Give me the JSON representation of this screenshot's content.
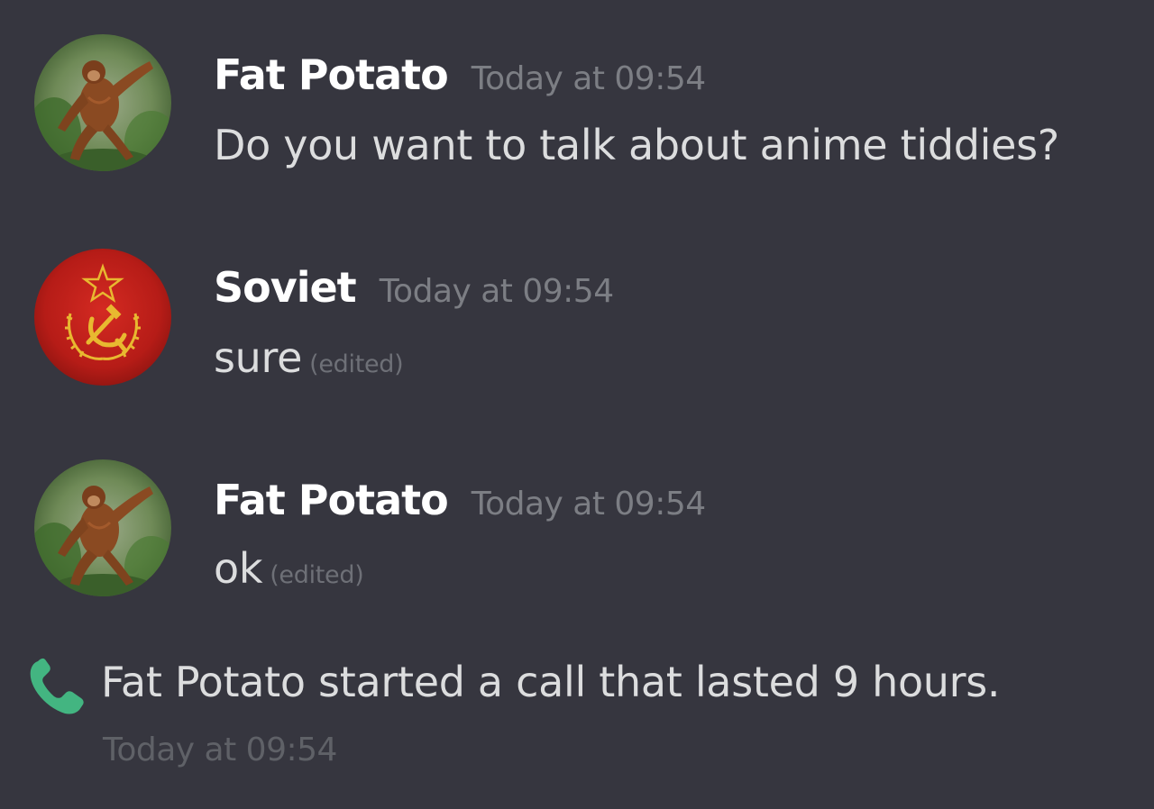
{
  "messages": [
    {
      "username": "Fat Potato",
      "timestamp": "Today at 09:54",
      "text": "Do you want to talk about anime tiddies?",
      "avatar_icon": "orangutan-avatar-icon"
    },
    {
      "username": "Soviet",
      "timestamp": "Today at 09:54",
      "text": "sure",
      "edited": "(edited)",
      "avatar_icon": "soviet-emblem-avatar-icon"
    },
    {
      "username": "Fat Potato",
      "timestamp": "Today at 09:54",
      "text": "ok",
      "edited": "(edited)",
      "avatar_icon": "orangutan-avatar-icon"
    }
  ],
  "call": {
    "text": "Fat Potato started a call that lasted 9 hours.",
    "timestamp": "Today at 09:54",
    "icon": "phone-icon",
    "icon_color": "#43b581"
  },
  "colors": {
    "background": "#36363f",
    "username": "#ffffff",
    "message_text": "#dcddde",
    "timestamp": "#7c7e84"
  }
}
